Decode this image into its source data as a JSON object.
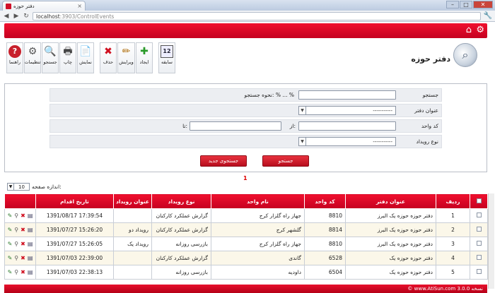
{
  "browser": {
    "tab_title": "دفتر حوزه",
    "url_host": "localhost",
    "url_rest": ":3903/ControlEvents",
    "win_min": "–",
    "win_max": "□",
    "win_close": "✕",
    "nav_back": "◀",
    "nav_forward": "▶",
    "nav_reload": "↻"
  },
  "header": {
    "home_icon": "⌂",
    "settings_icon": "⚙"
  },
  "page": {
    "title": "دفتر حوزه"
  },
  "toolbar": [
    {
      "name": "help",
      "label": "راهنما",
      "glyph": "?",
      "color": "#c8202c"
    },
    {
      "name": "settings",
      "label": "تنظیمات",
      "glyph": "⚙",
      "color": "#555"
    },
    {
      "name": "search",
      "label": "جستجو",
      "glyph": "🔍",
      "color": "#345"
    },
    {
      "name": "print",
      "label": "چاپ",
      "glyph": "🖶",
      "color": "#444"
    },
    {
      "name": "view",
      "label": "نمایش",
      "glyph": "📄",
      "color": "#446"
    },
    {
      "name": "delete",
      "label": "حذف",
      "glyph": "✖",
      "color": "#d01020"
    },
    {
      "name": "edit",
      "label": "ویرایش",
      "glyph": "✏",
      "color": "#b07010"
    },
    {
      "name": "create",
      "label": "ایجاد",
      "glyph": "✚",
      "color": "#2a9a2a"
    },
    {
      "name": "history",
      "label": "سابقه",
      "glyph": "12",
      "color": "#223"
    }
  ],
  "search": {
    "row1_label": "جستجو",
    "row1_hint": "نحوه جستجو: % ... %",
    "row2_label": "عنوان دفتر",
    "row2_value": "-----------",
    "row3_label": "کد واحد",
    "row3_from": "از:",
    "row3_to": "تا:",
    "row4_label": "نوع رویداد",
    "row4_value": "-----------",
    "search_button": "جستجو",
    "new_search_button": "جستجوی جدید"
  },
  "pager": {
    "page_number": "1",
    "page_size_label": "اندازه صفحه:",
    "page_size_value": "10"
  },
  "table": {
    "headers": {
      "row_no": "ردیف",
      "office_title": "عنوان دفتر",
      "unit_code": "کد واحد",
      "unit_name": "نام واحد",
      "event_type": "نوع رویداد",
      "event_title": "عنوان رویداد",
      "action_date": "تاریخ اقدام"
    },
    "rows": [
      {
        "no": "1",
        "office": "دفتر حوزه حوزه یک البرز",
        "code": "8810",
        "unit": "جهاز راه گلزار کرج",
        "type": "گزارش عملکرد کارکنان",
        "title": "",
        "date": "1391/08/17 17:39:54"
      },
      {
        "no": "2",
        "office": "دفتر حوزه حوزه یک البرز",
        "code": "8814",
        "unit": "گلشهر کرج",
        "type": "گزارش عملکرد کارکنان",
        "title": "رویداد دو",
        "date": "1391/07/27 15:26:20"
      },
      {
        "no": "3",
        "office": "دفتر حوزه حوزه یک البرز",
        "code": "8810",
        "unit": "جهاز راه گلزار کرج",
        "type": "بازرسی روزانه",
        "title": "رویداد یک",
        "date": "1391/07/27 15:26:05"
      },
      {
        "no": "4",
        "office": "دفتر حوزه حوزه یک",
        "code": "6528",
        "unit": "گاندی",
        "type": "گزارش عملکرد کارکنان",
        "title": "",
        "date": "1391/07/03 22:39:00"
      },
      {
        "no": "5",
        "office": "دفتر حوزه حوزه یک",
        "code": "6504",
        "unit": "داودیه",
        "type": "بازرسی روزانه",
        "title": "",
        "date": "1391/07/03 22:38:13"
      }
    ],
    "action_icons": [
      "✎",
      "⚲",
      "✖",
      "▤"
    ]
  },
  "footer": {
    "text": "© www.AtiSun.com  نسخه 3.0.0"
  }
}
